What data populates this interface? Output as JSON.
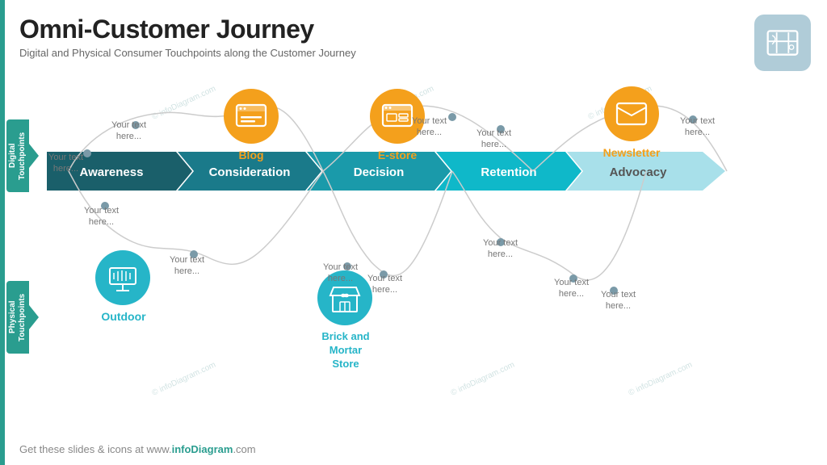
{
  "title": "Omni-Customer Journey",
  "subtitle": "Digital and Physical Consumer Touchpoints along the Customer Journey",
  "stages": [
    {
      "id": "awareness",
      "label": "Awareness"
    },
    {
      "id": "consideration",
      "label": "Consideration"
    },
    {
      "id": "decision",
      "label": "Decision"
    },
    {
      "id": "retention",
      "label": "Retention"
    },
    {
      "id": "advocacy",
      "label": "Advocacy"
    }
  ],
  "digital_label": "Digital\nTouchpoints",
  "physical_label": "Physical\nTouchpoints",
  "digital_icons": [
    {
      "name": "Blog",
      "type": "orange"
    },
    {
      "name": "E-store",
      "type": "orange"
    },
    {
      "name": "Newsletter",
      "type": "orange"
    }
  ],
  "physical_icons": [
    {
      "name": "Outdoor",
      "type": "teal"
    },
    {
      "name": "Brick and Mortar\nStore",
      "type": "teal"
    }
  ],
  "placeholder_text": "Your text here...",
  "footer": "Get these slides & icons at www.infoDiagram.com",
  "watermark": "© infoDiagram.com"
}
